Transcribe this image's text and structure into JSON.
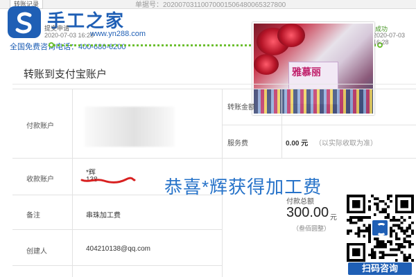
{
  "header": {
    "tab_label": "转账记录",
    "order_number": "单据号：20200703110070001506480065327800"
  },
  "watermark": {
    "title": "手工之家",
    "url": "www.yn288.com",
    "phone": "全国免费咨询电话：400-680-6200"
  },
  "progress": {
    "step_apply_label": "提交申请",
    "step_apply_date": "2020-07-03 16:28",
    "step_success_label": "成功",
    "step_success_date": "2020-07-03 16:28",
    "accent_color": "#6cbf2f"
  },
  "photo": {
    "brand": "雅慕丽"
  },
  "section": {
    "title": "转账到支付宝账户"
  },
  "table": {
    "payer_label": "付款账户",
    "amount_label": "转账金额",
    "service_fee_label": "服务费",
    "service_fee_value": "0.00 元",
    "service_fee_note": "（以实际收取为准）",
    "payee_label": "收款账户",
    "payee_name": "*辉",
    "payee_account": "138",
    "remark_label": "备注",
    "remark_value": "串珠加工费",
    "creator_label": "创建人",
    "creator_value": "404210138@qq.com",
    "total_label": "付款总额",
    "total_amount": "300.00",
    "total_unit": "元",
    "total_words": "（叁佰圆整）"
  },
  "overlay": {
    "congrats": "恭喜*辉获得加工费"
  },
  "qr": {
    "button_label": "扫码咨询"
  }
}
